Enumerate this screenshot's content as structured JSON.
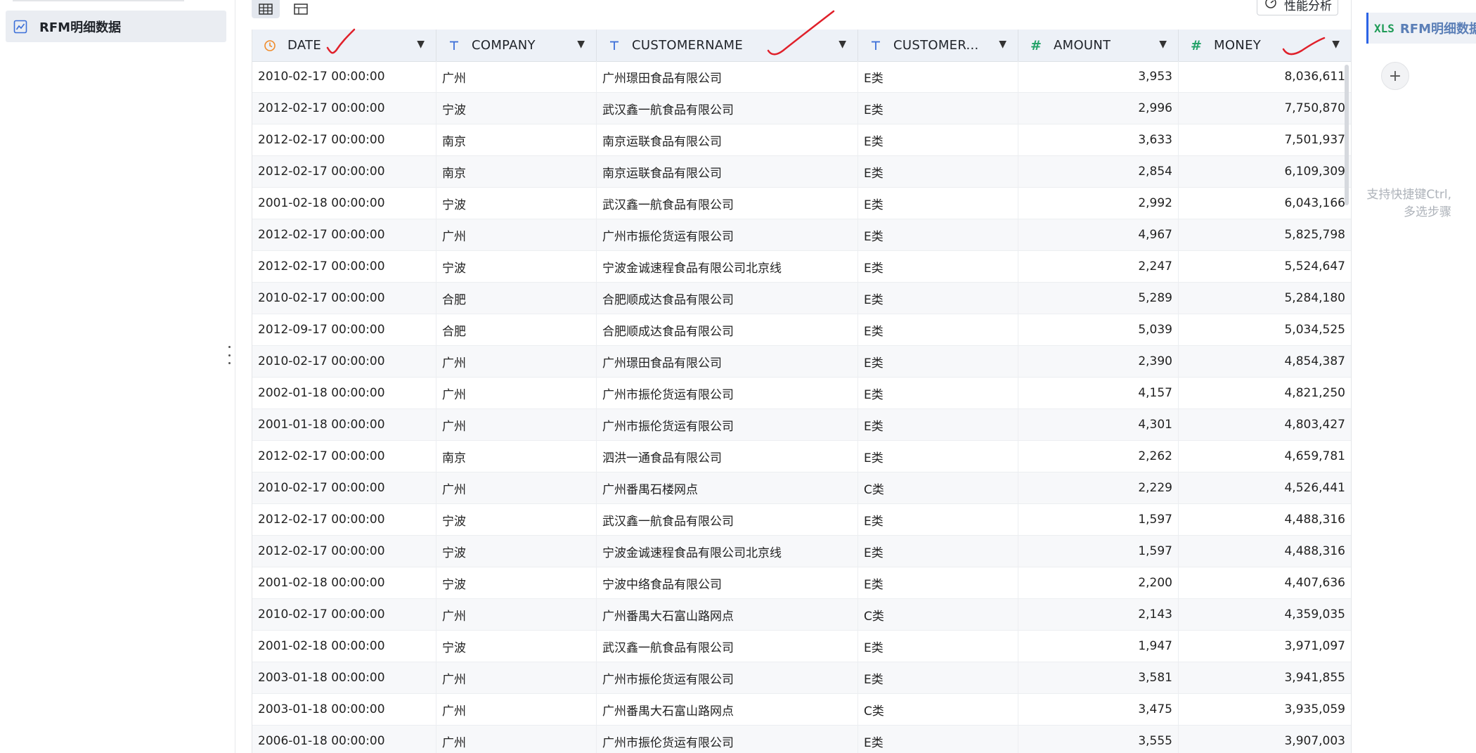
{
  "sidebar": {
    "items": [
      {
        "label": "RFM明细数据",
        "icon": "line-chart-icon"
      }
    ]
  },
  "toolbar": {
    "views": [
      {
        "name": "grid-view-icon",
        "active": true
      },
      {
        "name": "panel-view-icon",
        "active": false
      }
    ],
    "perf_button": "性能分析"
  },
  "table": {
    "columns": [
      {
        "name": "DATE",
        "type": "date",
        "icon": "clock-icon"
      },
      {
        "name": "COMPANY",
        "type": "text",
        "icon": "text-type-icon"
      },
      {
        "name": "CUSTOMERNAME",
        "type": "text",
        "icon": "text-type-icon"
      },
      {
        "name": "CUSTOMER...",
        "type": "text",
        "icon": "text-type-icon"
      },
      {
        "name": "AMOUNT",
        "type": "number",
        "icon": "hash-icon"
      },
      {
        "name": "MONEY",
        "type": "number",
        "icon": "hash-icon"
      }
    ],
    "rows": [
      [
        "2010-02-17 00:00:00",
        "广州",
        "广州璟田食品有限公司",
        "E类",
        "3,953",
        "8,036,611"
      ],
      [
        "2012-02-17 00:00:00",
        "宁波",
        "武汉鑫一航食品有限公司",
        "E类",
        "2,996",
        "7,750,870"
      ],
      [
        "2012-02-17 00:00:00",
        "南京",
        "南京运联食品有限公司",
        "E类",
        "3,633",
        "7,501,937"
      ],
      [
        "2012-02-17 00:00:00",
        "南京",
        "南京运联食品有限公司",
        "E类",
        "2,854",
        "6,109,309"
      ],
      [
        "2001-02-18 00:00:00",
        "宁波",
        "武汉鑫一航食品有限公司",
        "E类",
        "2,992",
        "6,043,166"
      ],
      [
        "2012-02-17 00:00:00",
        "广州",
        "广州市振伦货运有限公司",
        "E类",
        "4,967",
        "5,825,798"
      ],
      [
        "2012-02-17 00:00:00",
        "宁波",
        "宁波金诚速程食品有限公司北京线",
        "E类",
        "2,247",
        "5,524,647"
      ],
      [
        "2010-02-17 00:00:00",
        "合肥",
        "合肥顺成达食品有限公司",
        "E类",
        "5,289",
        "5,284,180"
      ],
      [
        "2012-09-17 00:00:00",
        "合肥",
        "合肥顺成达食品有限公司",
        "E类",
        "5,039",
        "5,034,525"
      ],
      [
        "2010-02-17 00:00:00",
        "广州",
        "广州璟田食品有限公司",
        "E类",
        "2,390",
        "4,854,387"
      ],
      [
        "2002-01-18 00:00:00",
        "广州",
        "广州市振伦货运有限公司",
        "E类",
        "4,157",
        "4,821,250"
      ],
      [
        "2001-01-18 00:00:00",
        "广州",
        "广州市振伦货运有限公司",
        "E类",
        "4,301",
        "4,803,427"
      ],
      [
        "2012-02-17 00:00:00",
        "南京",
        "泗洪一通食品有限公司",
        "E类",
        "2,262",
        "4,659,781"
      ],
      [
        "2010-02-17 00:00:00",
        "广州",
        "广州番禺石楼网点",
        "C类",
        "2,229",
        "4,526,441"
      ],
      [
        "2012-02-17 00:00:00",
        "宁波",
        "武汉鑫一航食品有限公司",
        "E类",
        "1,597",
        "4,488,316"
      ],
      [
        "2012-02-17 00:00:00",
        "宁波",
        "宁波金诚速程食品有限公司北京线",
        "E类",
        "1,597",
        "4,488,316"
      ],
      [
        "2001-02-18 00:00:00",
        "宁波",
        "宁波中络食品有限公司",
        "E类",
        "2,200",
        "4,407,636"
      ],
      [
        "2010-02-17 00:00:00",
        "广州",
        "广州番禺大石富山路网点",
        "C类",
        "2,143",
        "4,359,035"
      ],
      [
        "2001-02-18 00:00:00",
        "宁波",
        "武汉鑫一航食品有限公司",
        "E类",
        "1,947",
        "3,971,097"
      ],
      [
        "2003-01-18 00:00:00",
        "广州",
        "广州市振伦货运有限公司",
        "E类",
        "3,581",
        "3,941,855"
      ],
      [
        "2003-01-18 00:00:00",
        "广州",
        "广州番禺大石富山路网点",
        "C类",
        "3,475",
        "3,935,059"
      ],
      [
        "2006-01-18 00:00:00",
        "广州",
        "广州市振伦货运有限公司",
        "E类",
        "3,555",
        "3,907,003"
      ]
    ]
  },
  "steps_panel": {
    "steps": [
      {
        "label": "RFM明细数据",
        "icon_text": "XLS"
      }
    ],
    "add_label": "+",
    "hint_lines": [
      "支持快捷键Ctrl,",
      "多选步骤"
    ]
  },
  "annotation_color": "#e0202a"
}
